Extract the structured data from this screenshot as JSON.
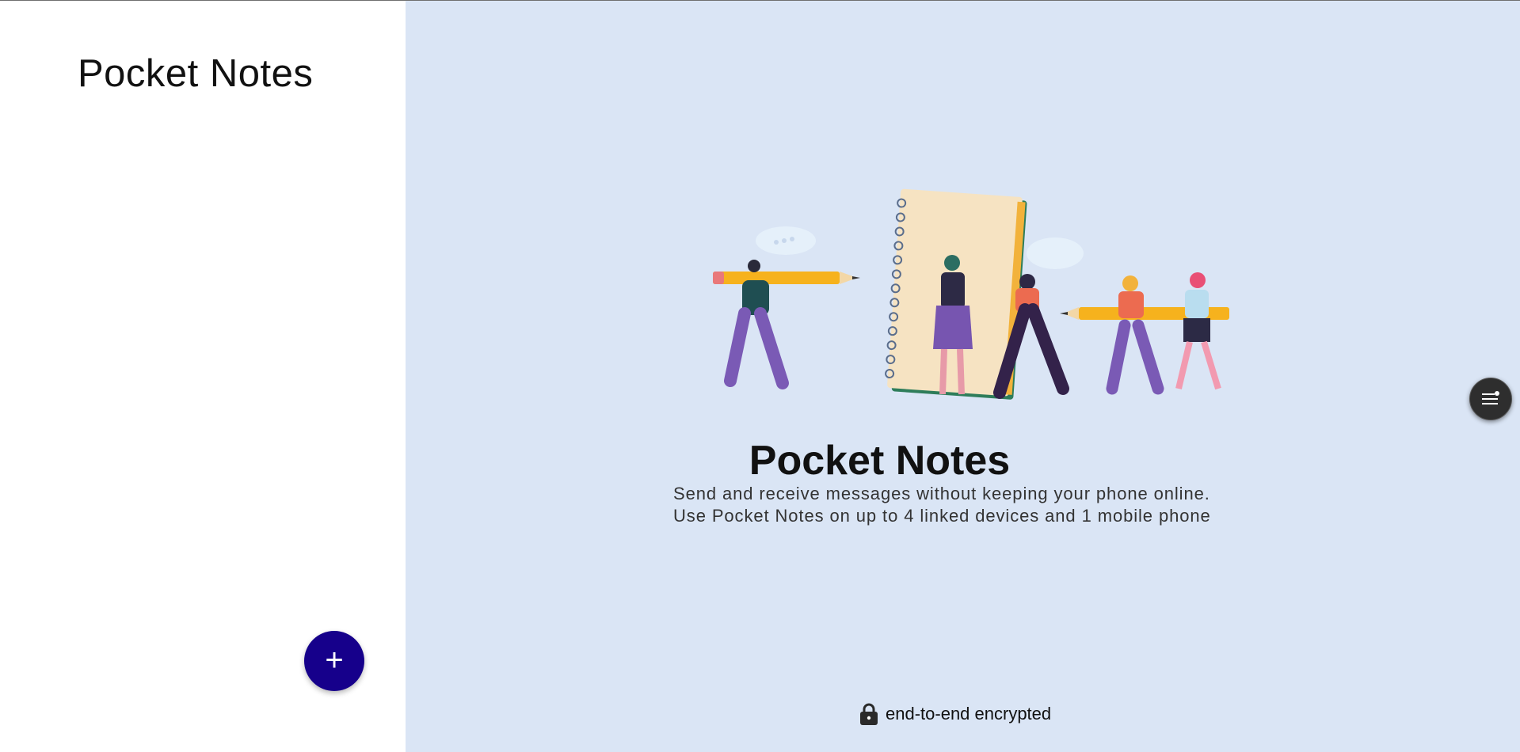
{
  "sidebar": {
    "title": "Pocket Notes",
    "add_button_label": "+"
  },
  "main": {
    "hero_illustration": "people-with-notebook-and-pencils",
    "heading": "Pocket Notes",
    "description_line1": "Send and receive messages without keeping your phone online.",
    "description_line2": "Use Pocket Notes on up to 4 linked devices and 1 mobile phone",
    "footer_text": "end-to-end encrypted",
    "footer_icon": "lock-icon"
  },
  "widget": {
    "icon": "menu-notification-icon"
  },
  "colors": {
    "sidebar_bg": "#ffffff",
    "main_bg": "#dae5f5",
    "accent": "#16008b"
  }
}
